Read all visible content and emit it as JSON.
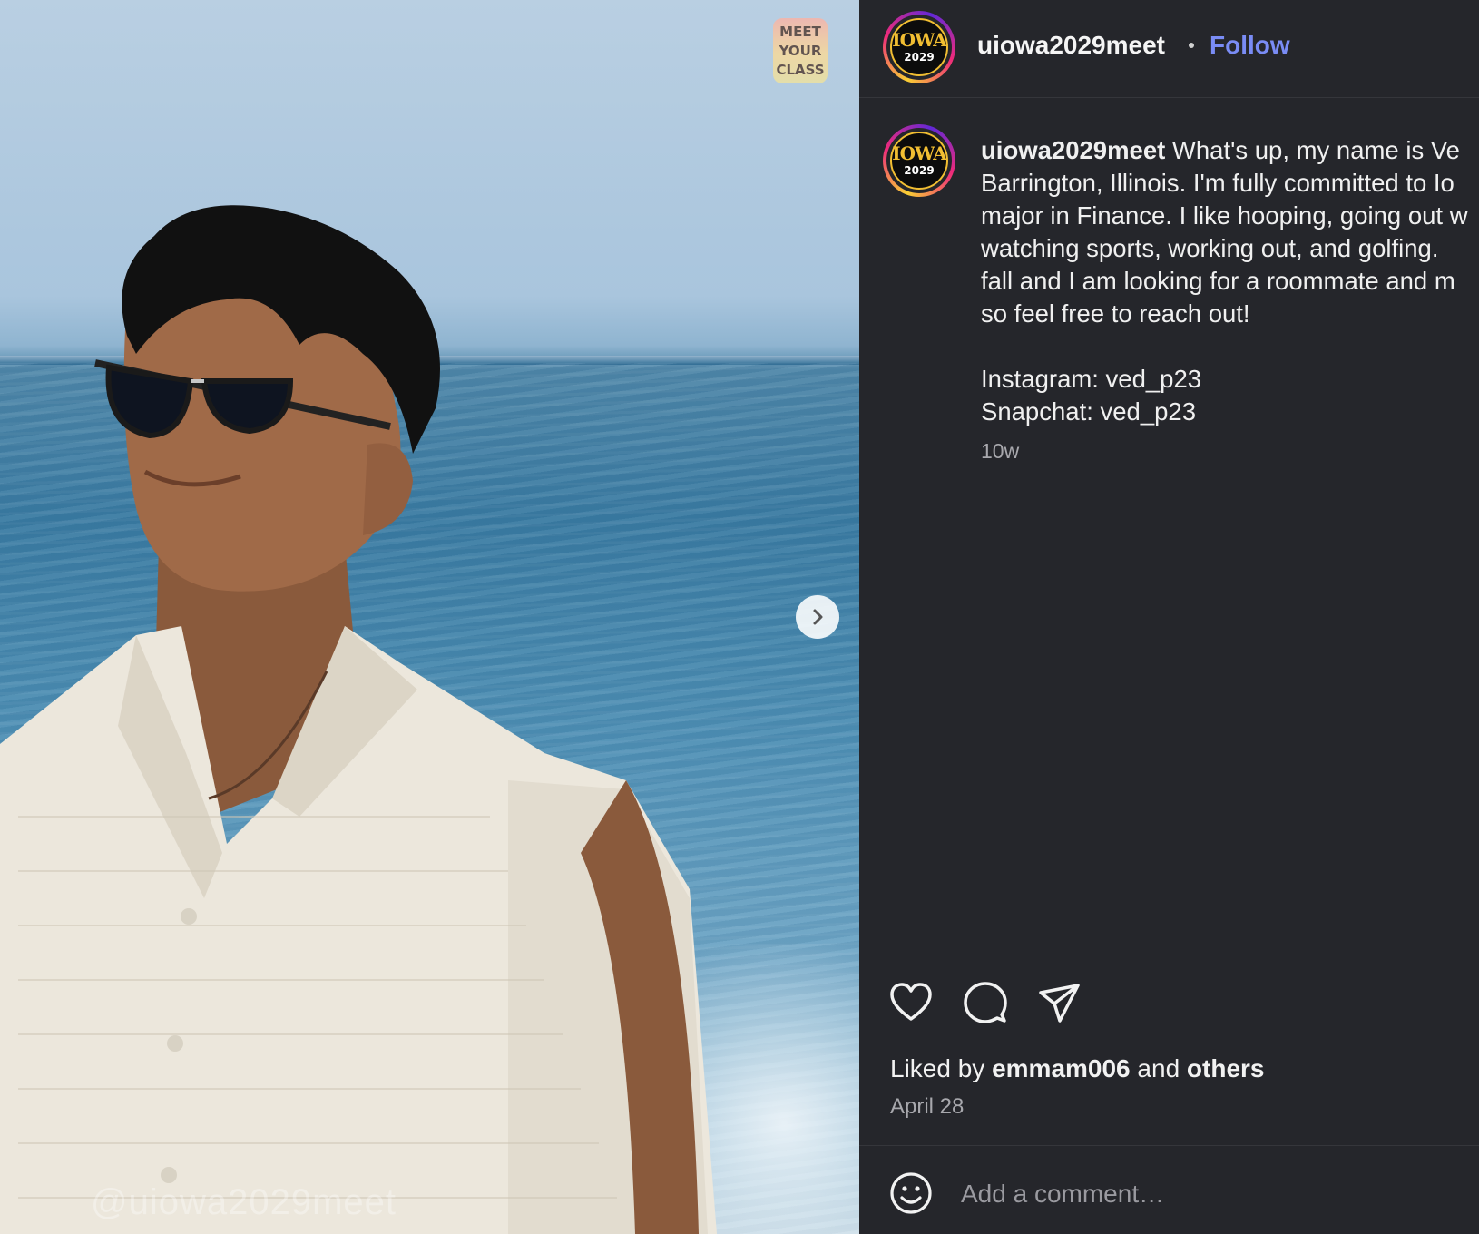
{
  "post": {
    "media": {
      "watermark": "@uiowa2029meet",
      "badge_lines": [
        "MEET",
        "YOUR",
        "CLASS"
      ]
    },
    "header": {
      "username": "uiowa2029meet",
      "follow_label": "Follow",
      "avatar_text": "IOWA",
      "avatar_year": "2029"
    },
    "caption": {
      "username": "uiowa2029meet",
      "text": " What's up, my name is Ve\nBarrington, Illinois. I'm fully committed to Io\nmajor in Finance. I like hooping, going out w\nwatching sports, working out, and golfing. \nfall and I am looking for a roommate and m\nso feel free to reach out!\n\nInstagram: ved_p23\nSnapchat: ved_p23",
      "time_ago": "10w"
    },
    "engagement": {
      "liked_prefix": "Liked by",
      "liked_user": "emmam006",
      "liked_and": "and",
      "liked_others": "others",
      "date": "April 28"
    },
    "comment": {
      "placeholder": "Add a comment…"
    },
    "colors": {
      "panel_bg": "#25262b",
      "follow": "#7a8cf5",
      "iowa_gold": "#f1be32"
    },
    "icons": [
      "heart-icon",
      "comment-icon",
      "share-icon",
      "emoji-icon",
      "chevron-right-icon"
    ]
  }
}
